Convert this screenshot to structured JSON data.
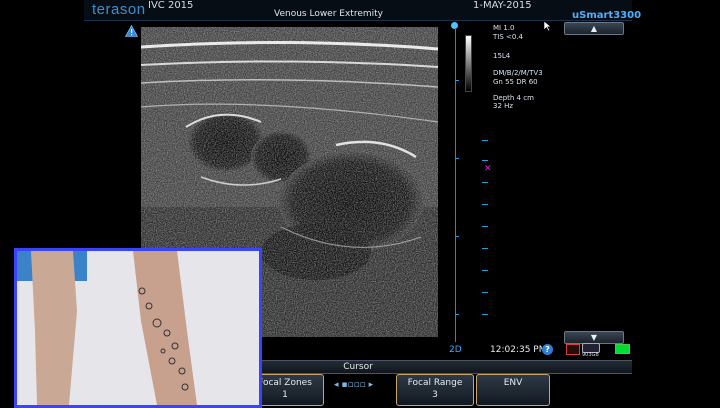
{
  "header": {
    "logo": "terason",
    "patient": "IVC 2015",
    "exam": "Venous Lower Extremity",
    "date": "1-MAY-2015",
    "model": "uSmart3300"
  },
  "info": {
    "mi": "MI  1.0",
    "tis": "TIS <0.4",
    "probe": "15L4",
    "preset": "DM/B/2/M/TV3",
    "gain": "Gn 55   DR 60",
    "depth": "Depth 4 cm",
    "rate": "32 Hz"
  },
  "status": {
    "mode": "2D",
    "time": "12:02:35 PM",
    "help": "?",
    "storage": "903GB"
  },
  "cursor_bar": {
    "label": "Cursor"
  },
  "controls": {
    "focal_zones": {
      "label": "Focal Zones",
      "value": "1"
    },
    "focal_range": {
      "label": "Focal Range",
      "value": "3"
    },
    "env": {
      "label": "ENV",
      "value": ""
    },
    "left_value": "1"
  },
  "nav": {
    "up_glyph": "▲",
    "down_glyph": "▼"
  },
  "colors": {
    "accent": "#3a8fd0",
    "model": "#4fb0ff",
    "control_border": "#c9a56b",
    "cam_border": "#3a44ff"
  }
}
